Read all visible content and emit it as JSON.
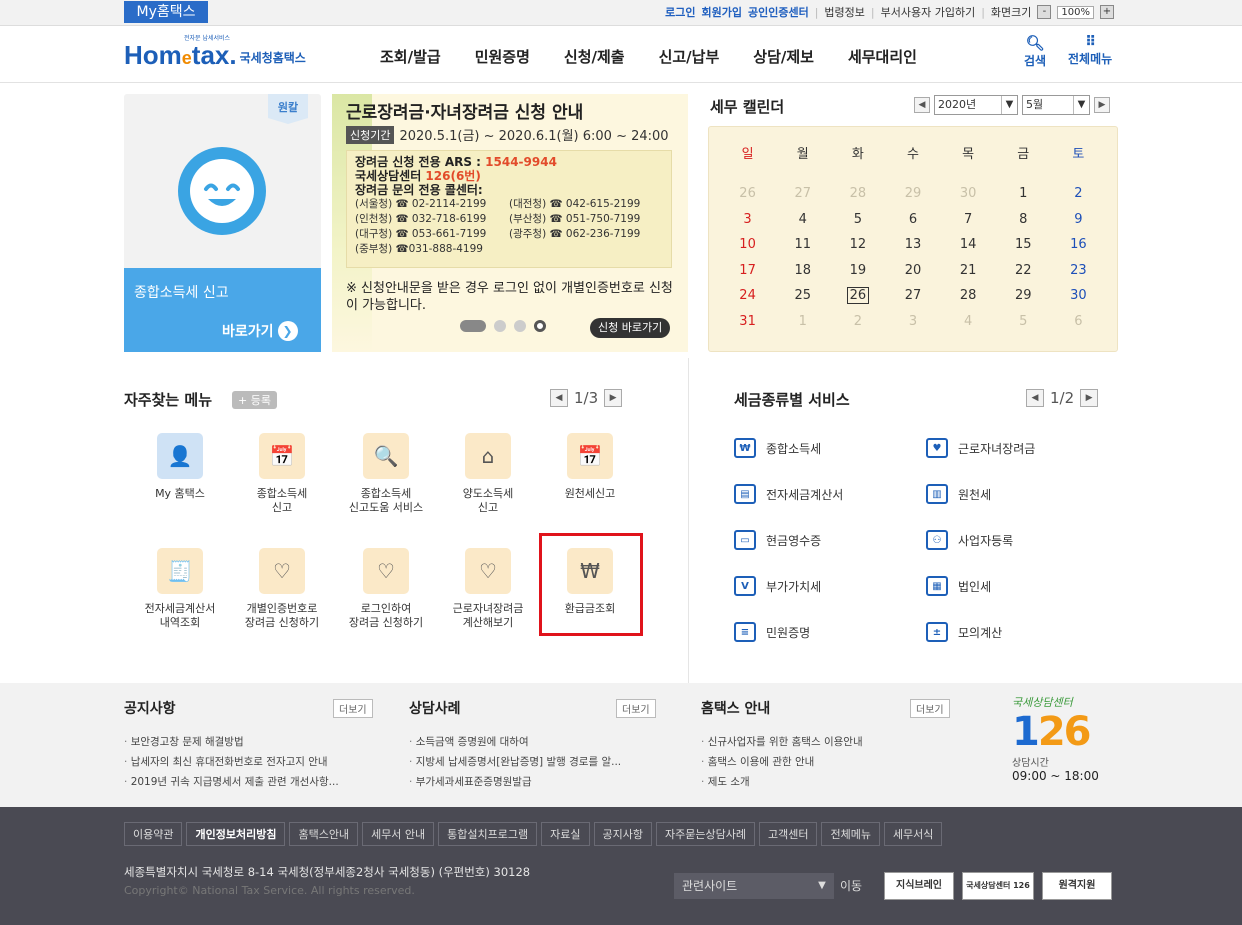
{
  "topbar": {
    "myhome_label": "My홈택스",
    "links": [
      "로그인",
      "회원가입",
      "공인인증센터",
      "법령정보",
      "부서사용자 가입하기",
      "화면크기"
    ],
    "zoom_minus": "-",
    "zoom_value": "100%",
    "zoom_plus": "+"
  },
  "header": {
    "logo_small": "전자문 납세서비스",
    "logo_home": "Hom",
    "logo_e": "e",
    "logo_tax": "tax.",
    "logo_sub": "국세청홈택스",
    "nav": [
      "조회/발급",
      "민원증명",
      "신청/제출",
      "신고/납부",
      "상담/제보",
      "세무대리인"
    ],
    "search_label": "검색",
    "allmenu_label": "전체메뉴"
  },
  "promo": {
    "tag": "원칼",
    "title": "종합소득세 신고",
    "go_label": "바로가기"
  },
  "banner": {
    "title": "근로장려금·자녀장려금 신청 안내",
    "period_tag": "신청기간",
    "period": "2020.5.1(금) ~ 2020.6.1(월) 6:00 ~ 24:00",
    "ars_label": "장려금 신청 전용 ARS : ",
    "ars_number": "1544-9944",
    "center_label": "국세상담센터 ",
    "center_number": "126(6번)",
    "callcenter_label": "장려금 문의 전용 콜센터:",
    "offices": [
      [
        "(서울청) ☎ 02-2114-2199",
        "(대전청) ☎ 042-615-2199"
      ],
      [
        "(인천청) ☎ 032-718-6199",
        "(부산청) ☎ 051-750-7199"
      ],
      [
        "(대구청) ☎ 053-661-7199",
        "(광주청) ☎ 062-236-7199"
      ],
      [
        "(중부청) ☎031-888-4199",
        ""
      ]
    ],
    "note": "※ 신청안내문을 받은 경우 로그인 없이 개별인증번호로 신청이 가능합니다.",
    "apply_label": "신청 바로가기"
  },
  "calendar": {
    "title": "세무 캘린더",
    "year": "2020년",
    "month": "5월",
    "weekdays": [
      "일",
      "월",
      "화",
      "수",
      "목",
      "금",
      "토"
    ],
    "days": [
      [
        "26",
        "27",
        "28",
        "29",
        "30",
        "1",
        "2"
      ],
      [
        "3",
        "4",
        "5",
        "6",
        "7",
        "8",
        "9"
      ],
      [
        "10",
        "11",
        "12",
        "13",
        "14",
        "15",
        "16"
      ],
      [
        "17",
        "18",
        "19",
        "20",
        "21",
        "22",
        "23"
      ],
      [
        "24",
        "25",
        "26",
        "27",
        "28",
        "29",
        "30"
      ],
      [
        "31",
        "1",
        "2",
        "3",
        "4",
        "5",
        "6"
      ]
    ],
    "today": "26"
  },
  "favorites": {
    "title": "자주찾는 메뉴",
    "register_label": "+ 등록",
    "page": "1/3",
    "items": [
      {
        "label": "My 홈택스",
        "icon": "person-icon",
        "glyph": "👤"
      },
      {
        "label": "종합소득세\n신고",
        "icon": "calendar-pen-icon",
        "glyph": "📅"
      },
      {
        "label": "종합소득세\n신고도움 서비스",
        "icon": "document-search-icon",
        "glyph": "🔍"
      },
      {
        "label": "양도소득세\n신고",
        "icon": "house-icon",
        "glyph": "⌂"
      },
      {
        "label": "원천세신고",
        "icon": "calendar-pen-icon",
        "glyph": "📅"
      },
      {
        "label": "전자세금계산서\n내역조회",
        "icon": "invoice-search-icon",
        "glyph": "🧾"
      },
      {
        "label": "개별인증번호로\n장려금 신청하기",
        "icon": "heart-hand-icon",
        "glyph": "♡"
      },
      {
        "label": "로그인하여\n장려금 신청하기",
        "icon": "heart-pen-icon",
        "glyph": "♡"
      },
      {
        "label": "근로자녀장려금\n계산해보기",
        "icon": "heart-calculator-icon",
        "glyph": "♡"
      },
      {
        "label": "환급금조회",
        "icon": "refund-won-icon",
        "glyph": "₩"
      }
    ]
  },
  "services": {
    "title": "세금종류별 서비스",
    "page": "1/2",
    "items": [
      {
        "label": "종합소득세",
        "icon": "money-bag-icon",
        "glyph": "₩"
      },
      {
        "label": "근로자녀장려금",
        "icon": "heart-icon",
        "glyph": "♥"
      },
      {
        "label": "전자세금계산서",
        "icon": "invoice-icon",
        "glyph": "▤"
      },
      {
        "label": "원천세",
        "icon": "tax-document-icon",
        "glyph": "▥"
      },
      {
        "label": "현금영수증",
        "icon": "receipt-icon",
        "glyph": "▭"
      },
      {
        "label": "사업자등록",
        "icon": "person-icon",
        "glyph": "⚇"
      },
      {
        "label": "부가가치세",
        "icon": "vat-icon",
        "glyph": "V"
      },
      {
        "label": "법인세",
        "icon": "building-icon",
        "glyph": "▦"
      },
      {
        "label": "민원증명",
        "icon": "certificate-icon",
        "glyph": "≡"
      },
      {
        "label": "모의계산",
        "icon": "calculator-icon",
        "glyph": "±"
      }
    ]
  },
  "notice": {
    "more_label": "더보기",
    "columns": [
      {
        "title": "공지사항",
        "items": [
          "보안경고창 문제 해결방법",
          "납세자의 최신 휴대전화번호로 전자고지 안내",
          "2019년 귀속 지급명세서 제출 관련 개선사항..."
        ]
      },
      {
        "title": "상담사례",
        "items": [
          "소득금액 증명원에 대하여",
          "지방세 납세증명서[완납증명] 발행 경로를 알...",
          "부가세과세표준증명원발급"
        ]
      },
      {
        "title": "홈택스 안내",
        "items": [
          "신규사업자를 위한 홈택스 이용안내",
          "홈택스 이용에 관한 안내",
          "제도 소개"
        ]
      }
    ],
    "center_title": "국세상담센터",
    "center_num_a": "1",
    "center_num_b": "26",
    "center_hours_label": "상담시간",
    "center_hours": "09:00 ~ 18:00"
  },
  "footer": {
    "links": [
      "이용약관",
      "개인정보처리방침",
      "홈택스안내",
      "세무서 안내",
      "통합설치프로그램",
      "자료실",
      "공지사항",
      "자주묻는상담사례",
      "고객센터",
      "전체메뉴",
      "세무서식"
    ],
    "address": "세종특별자치시 국세청로 8-14 국세청(정부세종2청사 국세청동) (우편번호) 30128",
    "copyright": "Copyright© National Tax Service. All rights reserved.",
    "related_label": "관련사이트",
    "move_label": "이동",
    "badge1": "지식브레인",
    "badge2": "국세상담센터 126",
    "badge3": "원격지원"
  }
}
